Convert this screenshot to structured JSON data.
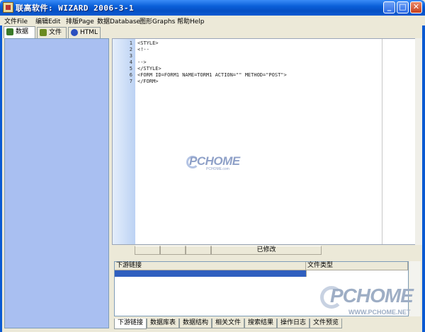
{
  "window": {
    "title": "联高软件: WIZARD 2006-3-1",
    "minimize_label": "_",
    "maximize_label": "□",
    "close_label": "✕"
  },
  "menu": [
    "文件File",
    "编辑Edit",
    "排版Page",
    "数据Database",
    "图形Graphs",
    "帮助Help"
  ],
  "left_tabs": [
    {
      "label": "数据",
      "icon": "database-icon",
      "color": "#3a7a2a"
    },
    {
      "label": "文件",
      "icon": "file-icon",
      "color": "#6a8a20"
    },
    {
      "label": "HTML",
      "icon": "globe-icon",
      "color": "#2a4fbf"
    }
  ],
  "editor": {
    "lines": [
      {
        "num": "1",
        "text": "<STYLE>"
      },
      {
        "num": "2",
        "text": "<!--"
      },
      {
        "num": "3",
        "text": ""
      },
      {
        "num": "4",
        "text": "-->"
      },
      {
        "num": "5",
        "text": "</STYLE>"
      },
      {
        "num": "6",
        "text": "<FORM ID=FORM1 NAME=TORM1 ACTION=\"\" METHOD=\"POST\">"
      },
      {
        "num": "7",
        "text": "</FORM>"
      }
    ],
    "status_modified": "已修改"
  },
  "watermark": {
    "brand": "PCHOME",
    "small_domain": "PCHOME.com",
    "big_domain": "WWW.PCHOME.NET"
  },
  "list": {
    "columns": [
      "下游链接",
      "文件类型"
    ]
  },
  "bottom_tabs": [
    "下游链接",
    "数据库表",
    "数据结构",
    "相关文件",
    "搜索结果",
    "操作日志",
    "文件预览"
  ],
  "colors": {
    "title_bar": "#0a5ad2",
    "left_panel": "#a9bff1",
    "selection": "#2f5fbf"
  }
}
